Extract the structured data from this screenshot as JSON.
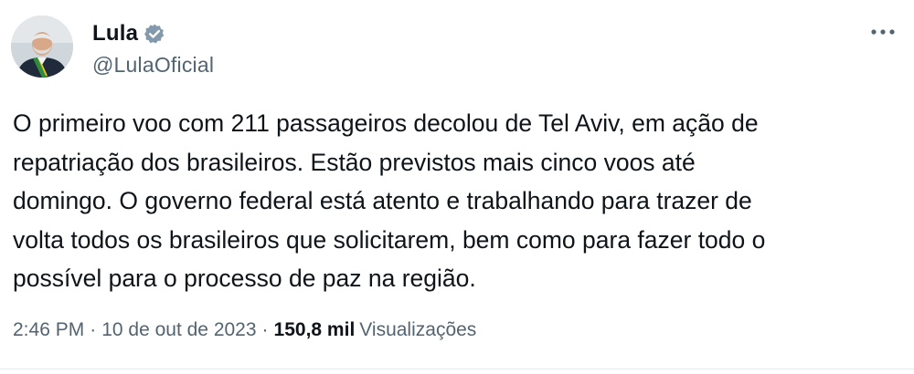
{
  "author": {
    "display_name": "Lula",
    "handle": "@LulaOficial",
    "verified": true,
    "avatar_icon": "profile-photo-avatar"
  },
  "tweet": {
    "text": "O primeiro voo com 211 passageiros decolou de Tel Aviv, em ação de\nrepatriação dos brasileiros. Estão previstos mais cinco voos até\ndomingo. O governo federal está atento e trabalhando para trazer de\nvolta todos os brasileiros que solicitarem, bem como para fazer todo o\npossível para o processo de paz na região."
  },
  "meta": {
    "time": "2:46 PM",
    "separator": "·",
    "date": "10 de out de 2023",
    "views_count": "150,8 mil",
    "views_label": "Visualizações"
  },
  "icons": {
    "more": "more-options-icon",
    "verified": "verified-badge-icon"
  },
  "colors": {
    "text_primary": "#0f1419",
    "text_secondary": "#536471",
    "verified_badge": "#829aab"
  }
}
